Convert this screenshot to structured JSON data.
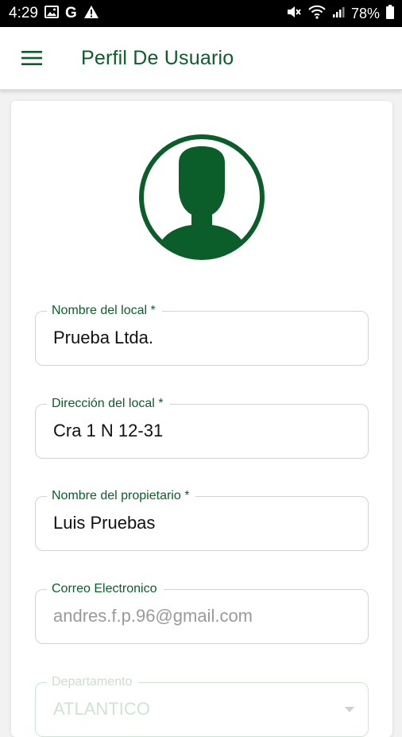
{
  "status_bar": {
    "time": "4:29",
    "g_letter": "G",
    "battery": "78%",
    "icons": [
      "image-icon",
      "google-icon",
      "warning-icon",
      "mute-icon",
      "wifi-icon",
      "signal-icon",
      "battery-icon"
    ]
  },
  "app_bar": {
    "title": "Perfil De Usuario",
    "menu_icon": "hamburger-menu-icon"
  },
  "profile": {
    "avatar_icon": "user-avatar-icon",
    "fields": [
      {
        "label": "Nombre del local *",
        "value": "Prueba Ltda."
      },
      {
        "label": "Dirección del local *",
        "value": "Cra 1 N 12-31"
      },
      {
        "label": "Nombre del propietario *",
        "value": "Luis Pruebas"
      },
      {
        "label": "Correo Electronico",
        "value": "andres.f.p.96@gmail.com"
      },
      {
        "label": "Departamento",
        "value": "ATLANTICO"
      }
    ]
  },
  "colors": {
    "primary": "#0b5e2a",
    "status_bar": "#000000",
    "disabled_text": "#9a9a9a"
  }
}
